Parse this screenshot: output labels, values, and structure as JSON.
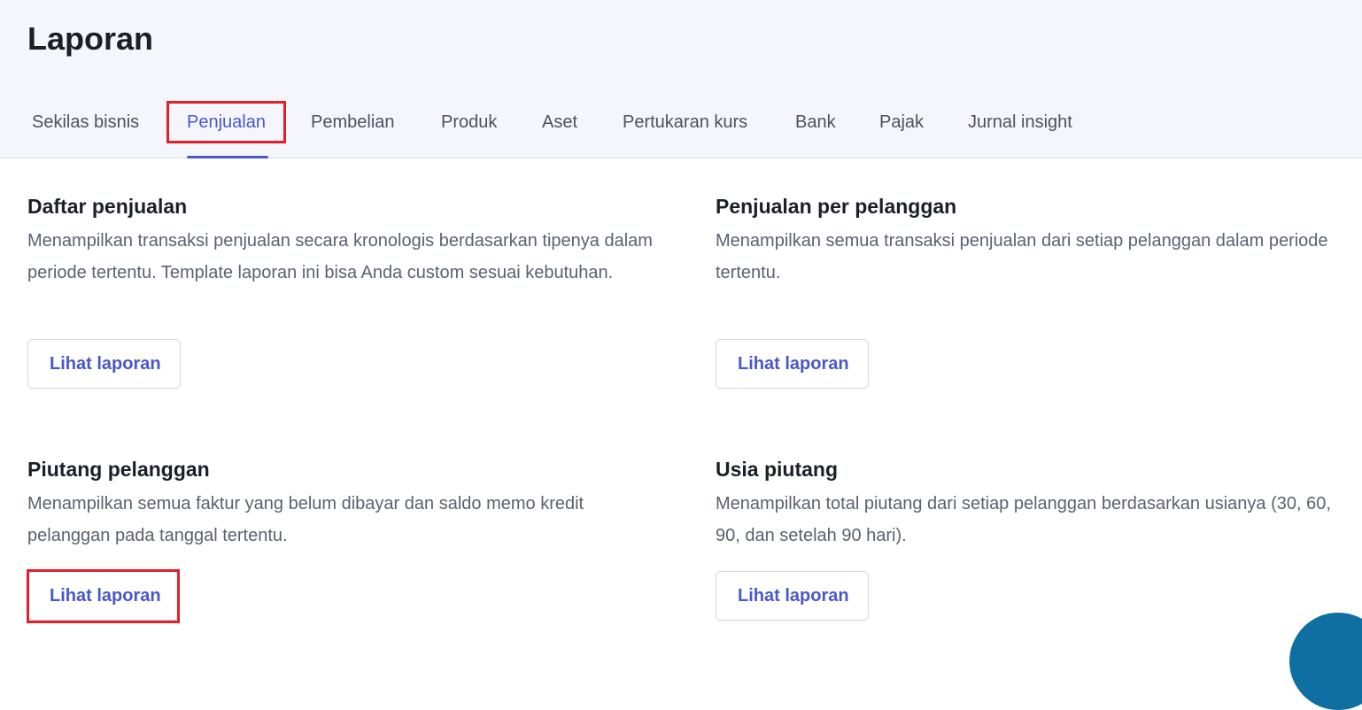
{
  "header": {
    "title": "Laporan"
  },
  "tabs": [
    {
      "label": "Sekilas bisnis",
      "active": false
    },
    {
      "label": "Penjualan",
      "active": true
    },
    {
      "label": "Pembelian",
      "active": false
    },
    {
      "label": "Produk",
      "active": false
    },
    {
      "label": "Aset",
      "active": false
    },
    {
      "label": "Pertukaran kurs",
      "active": false
    },
    {
      "label": "Bank",
      "active": false
    },
    {
      "label": "Pajak",
      "active": false
    },
    {
      "label": "Jurnal insight",
      "active": false
    }
  ],
  "reports": [
    {
      "title": "Daftar penjualan",
      "description": "Menampilkan transaksi penjualan secara kronologis berdasarkan tipenya dalam periode tertentu. Template laporan ini bisa Anda custom sesuai kebutuhan.",
      "button_label": "Lihat laporan"
    },
    {
      "title": "Penjualan per pelanggan",
      "description": "Menampilkan semua transaksi penjualan dari setiap pelanggan dalam periode tertentu.",
      "button_label": "Lihat laporan"
    },
    {
      "title": "Piutang pelanggan",
      "description": "Menampilkan semua faktur yang belum dibayar dan saldo memo kredit pelanggan pada tanggal tertentu.",
      "button_label": "Lihat laporan"
    },
    {
      "title": "Usia piutang",
      "description": "Menampilkan total piutang dari setiap pelanggan berdasarkan usianya (30, 60, 90, dan setelah 90 hari).",
      "button_label": "Lihat laporan"
    }
  ],
  "colors": {
    "accent": "#4a57c7",
    "highlight": "#e0202a",
    "header_bg": "#f4f6fb",
    "fab": "#0f6fa3"
  }
}
